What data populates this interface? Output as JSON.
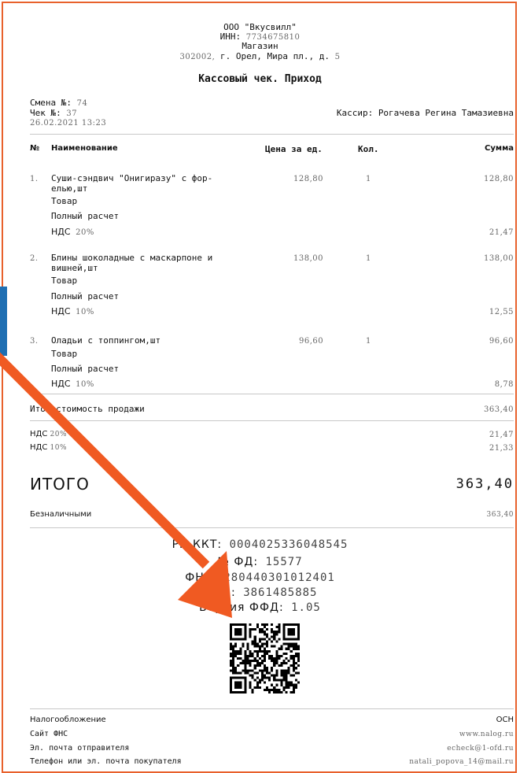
{
  "header": {
    "company": "ООО \"Вкусвилл\"",
    "inn_label": "ИНН:",
    "inn_value": "7734675810",
    "store": "Магазин",
    "address_prefix": "302002,",
    "address": "г. Орел, Мира пл., д.",
    "address_num": "5",
    "title": "Кассовый чек. Приход"
  },
  "meta": {
    "shift_label": "Смена №:",
    "shift_value": "74",
    "check_label": "Чек №:",
    "check_value": "37",
    "datetime": "26.02.2021 13:23",
    "cashier_label": "Кассир:",
    "cashier_value": "Рогачева Регина Тамазиевна"
  },
  "columns": {
    "num": "№",
    "name": "Наименование",
    "price": "Цена за ед.",
    "qty": "Кол.",
    "sum": "Сумма"
  },
  "items": [
    {
      "num": "1.",
      "name1": "Суши-сэндвич \"Онигиразу\" с фор-",
      "name2": "елью,шт",
      "price": "128,80",
      "qty": "1",
      "sum": "128,80",
      "type": "Товар",
      "payment": "Полный расчет",
      "vat_label": "НДС",
      "vat_rate": "20%",
      "vat_sum": "21,47"
    },
    {
      "num": "2.",
      "name1": "Блины шоколадные с маскарпоне и",
      "name2": "вишней,шт",
      "price": "138,00",
      "qty": "1",
      "sum": "138,00",
      "type": "Товар",
      "payment": "Полный расчет",
      "vat_label": "НДС",
      "vat_rate": "10%",
      "vat_sum": "12,55"
    },
    {
      "num": "3.",
      "name1": "Оладьи с топпингом,шт",
      "name2": "",
      "price": "96,60",
      "qty": "1",
      "sum": "96,60",
      "type": "Товар",
      "payment": "Полный расчет",
      "vat_label": "НДС",
      "vat_rate": "10%",
      "vat_sum": "8,78"
    }
  ],
  "totals": {
    "sale_total_label": "Итог стоимость продажи",
    "sale_total_value": "363,40",
    "vat20_label": "НДС",
    "vat20_rate": "20%",
    "vat20_value": "21,47",
    "vat10_label": "НДС",
    "vat10_rate": "10%",
    "vat10_value": "21,33",
    "itogo_label": "ИТОГО",
    "itogo_value": "363,40",
    "cashless_label": "Безналичными",
    "cashless_value": "363,40"
  },
  "fiscal": {
    "rn_label": "РН ККТ:",
    "rn_value": "0004025336048545",
    "fd_label": "№ ФД:",
    "fd_value": "15577",
    "fn_label": "ФН:",
    "fn_value": "9280440301012401",
    "fpd_label": "ФПД:",
    "fpd_value": "3861485885",
    "ffd_label": "Версия ФФД:",
    "ffd_value": "1.05"
  },
  "footer": {
    "tax_label": "Налогообложение",
    "tax_value": "ОСН",
    "fns_label": "Сайт ФНС",
    "fns_value": "www.nalog.ru",
    "sender_label": "Эл. почта отправителя",
    "sender_value": "echeck@1-ofd.ru",
    "buyer_label": "Телефон или эл. почта покупателя",
    "buyer_value": "natali_popova_14@mail.ru"
  },
  "colors": {
    "arrow": "#f05a22",
    "frame": "#e8612c",
    "side_tab": "#1f6fb3"
  }
}
